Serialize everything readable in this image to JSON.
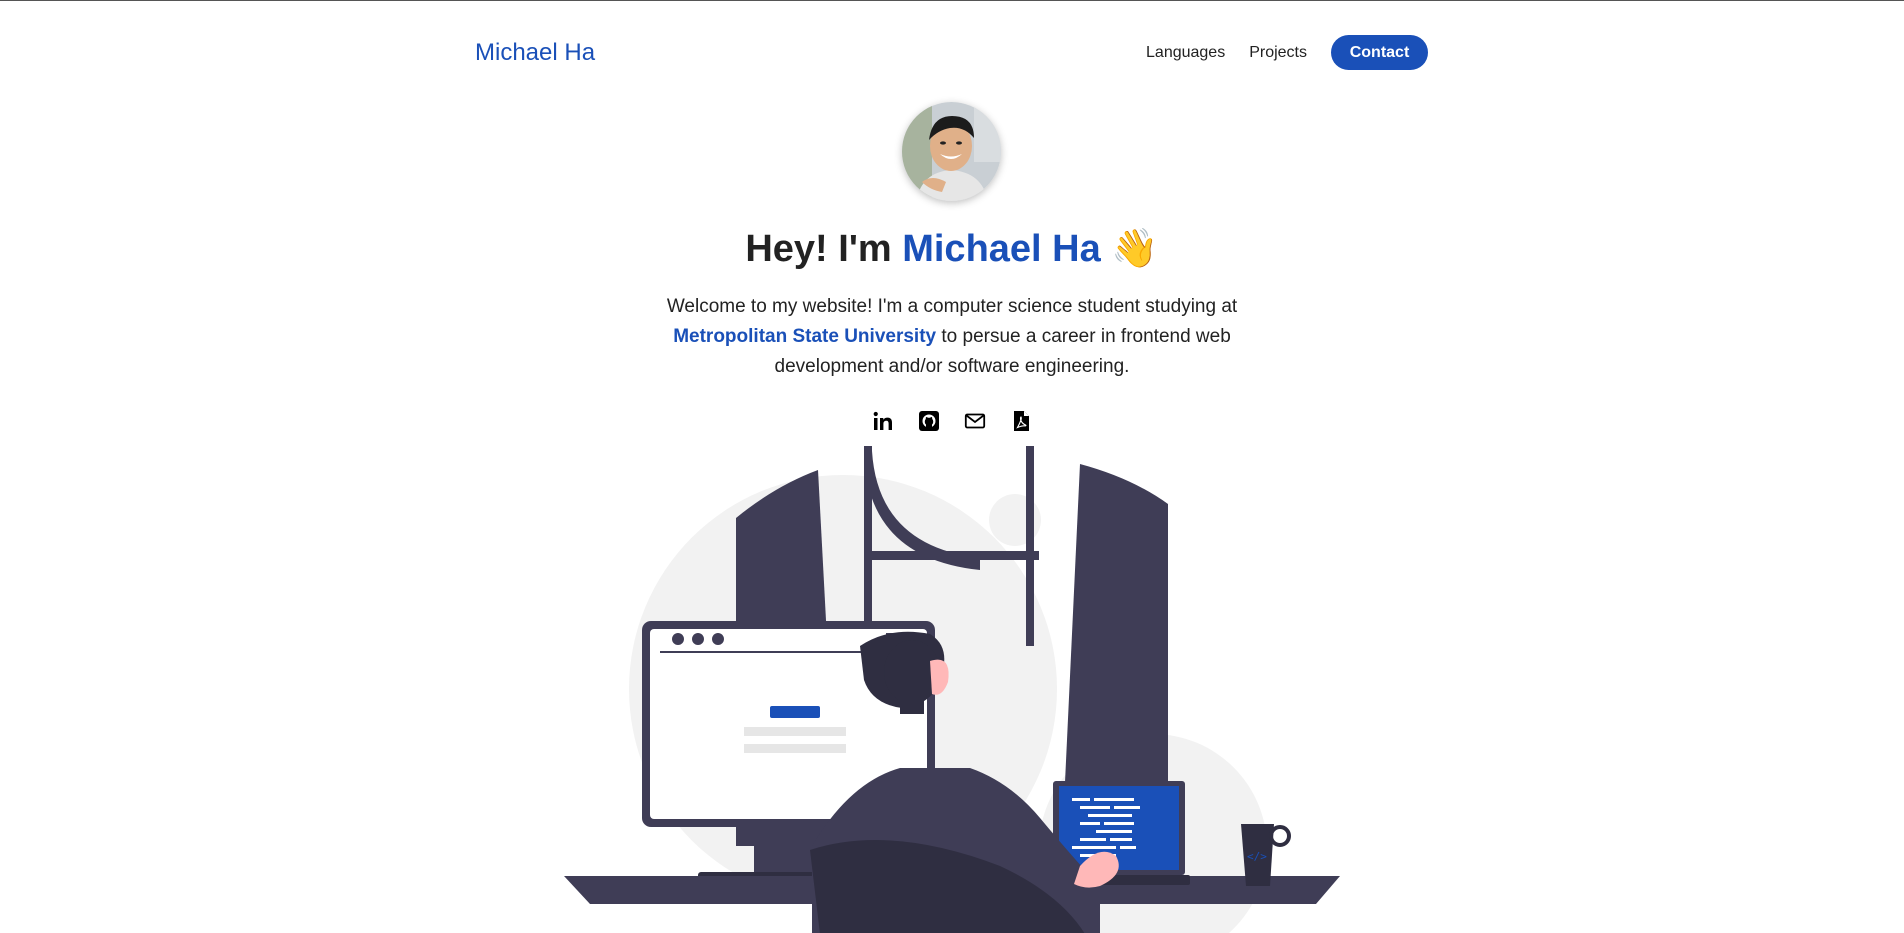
{
  "nav": {
    "brand": "Michael Ha",
    "links": [
      "Languages",
      "Projects"
    ],
    "contact_label": "Contact"
  },
  "hero": {
    "greeting": "Hey! I'm",
    "name": "Michael Ha",
    "emoji": "👋",
    "intro_before": "Welcome to my website! I'm a computer science student studying at",
    "university": "Metropolitan State University",
    "intro_after": "to persue a career in frontend web development and/or software engineering."
  },
  "socials": [
    {
      "icon": "linkedin-icon"
    },
    {
      "icon": "github-icon"
    },
    {
      "icon": "mail-icon"
    },
    {
      "icon": "pdf-file-icon"
    }
  ],
  "colors": {
    "accent": "#1a50b8",
    "illustration_dark": "#3f3d56",
    "illustration_light": "#f2f2f2"
  }
}
